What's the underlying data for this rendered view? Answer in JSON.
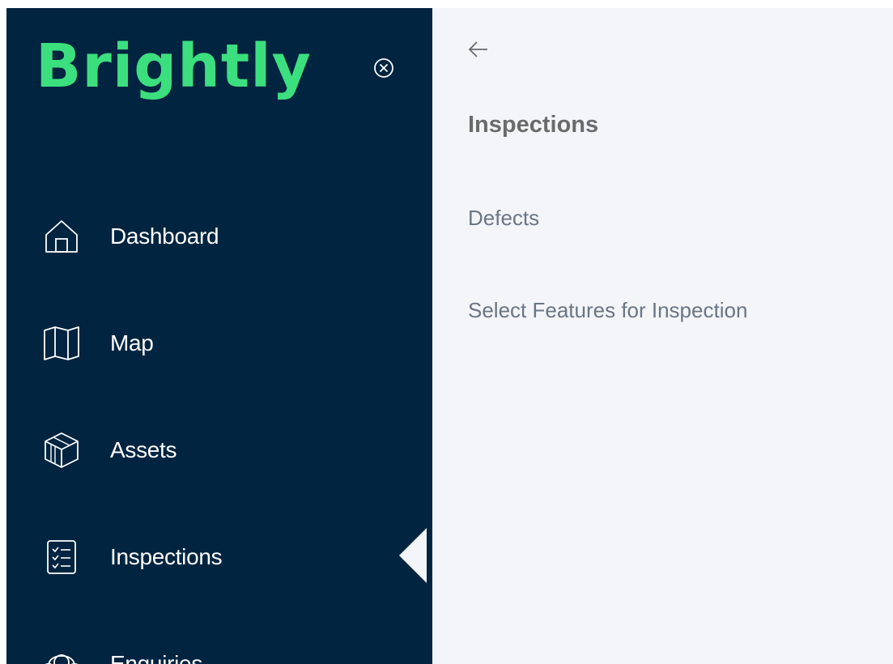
{
  "brand": {
    "logo_text": "Brightly",
    "accent_color": "#3cdf7e",
    "sidebar_color": "#012440",
    "panel_color": "#f4f5f9"
  },
  "sidebar": {
    "close_icon": "circle-x-icon",
    "items": [
      {
        "label": "Dashboard",
        "icon": "home-icon"
      },
      {
        "label": "Map",
        "icon": "map-icon"
      },
      {
        "label": "Assets",
        "icon": "box-icon"
      },
      {
        "label": "Inspections",
        "icon": "checklist-icon",
        "active": true
      },
      {
        "label": "Enquiries",
        "icon": "headset-icon"
      }
    ]
  },
  "panel": {
    "back_icon": "arrow-left-icon",
    "title": "Inspections",
    "links": [
      {
        "label": "Defects"
      },
      {
        "label": "Select Features for Inspection"
      }
    ]
  }
}
